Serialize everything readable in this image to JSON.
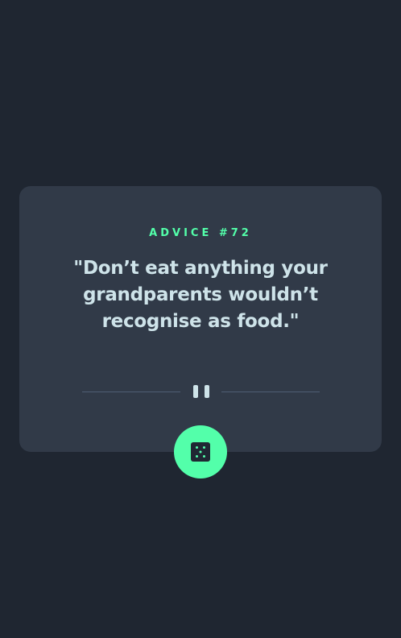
{
  "card": {
    "label": "ADVICE #72",
    "quote": "\"Don’t eat anything your grandparents wouldn’t recognise as food.\""
  },
  "icons": {
    "divider": "pause-icon",
    "button": "dice-icon"
  },
  "colors": {
    "background": "#1f2631",
    "card": "#313a48",
    "accent": "#53ffaa",
    "text": "#cee3e9",
    "divider": "#4f5d74"
  }
}
